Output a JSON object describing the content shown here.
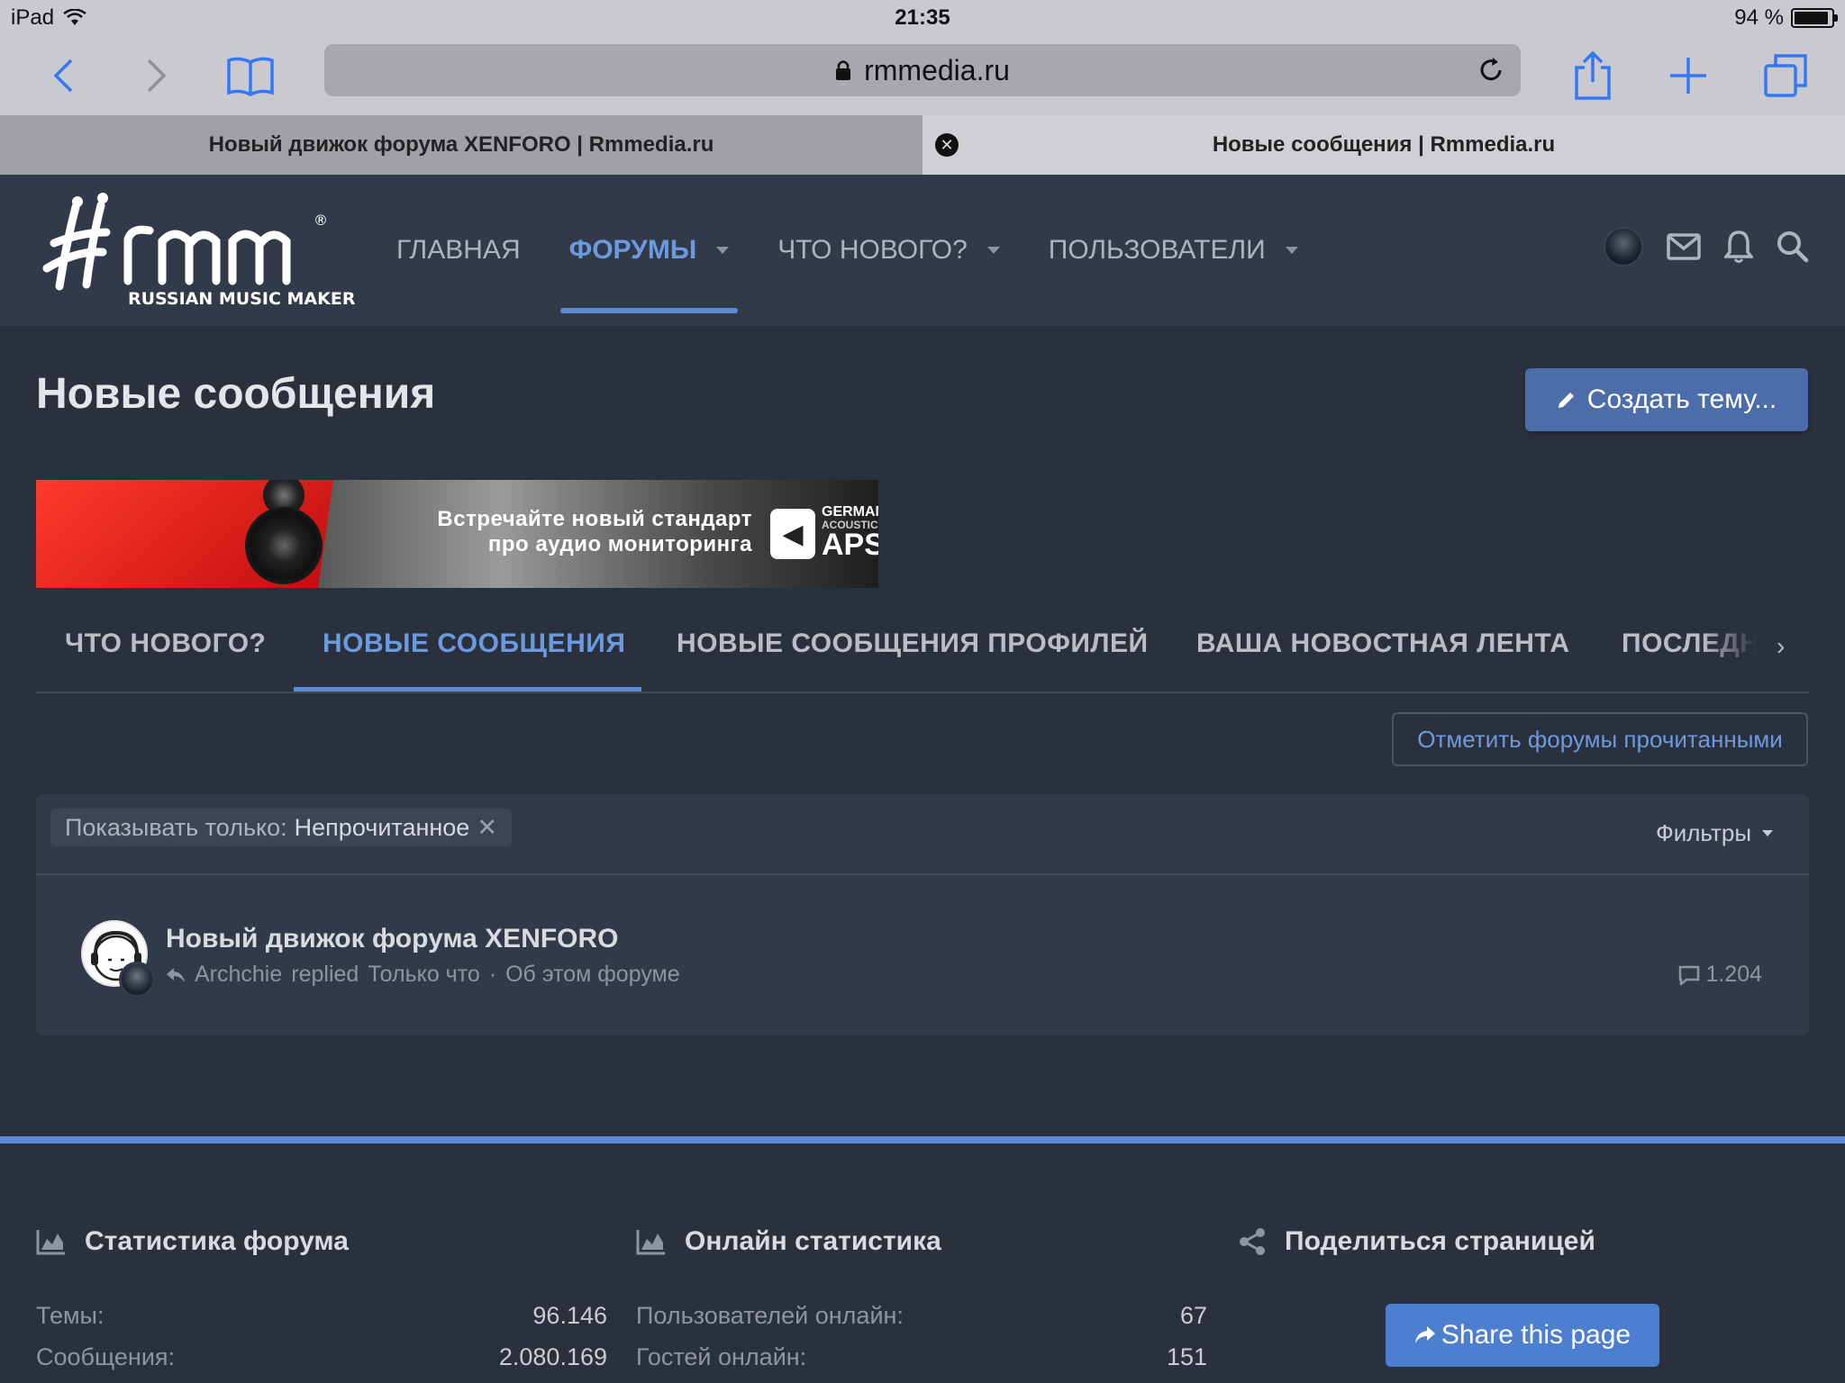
{
  "status_bar": {
    "device": "iPad",
    "time": "21:35",
    "battery": "94 %",
    "battery_level": 0.94
  },
  "browser": {
    "url": "rmmedia.ru",
    "tabs": [
      {
        "title": "Новый движок форума XENFORO | Rmmedia.ru",
        "active": false
      },
      {
        "title": "Новые сообщения | Rmmedia.ru",
        "active": true
      }
    ]
  },
  "site": {
    "logo_text": "RUSSIAN MUSIC MAKERS",
    "logo_mark": "rmm",
    "nav": [
      {
        "label": "ГЛАВНАЯ",
        "active": false,
        "dropdown": false
      },
      {
        "label": "ФОРУМЫ",
        "active": true,
        "dropdown": true
      },
      {
        "label": "ЧТО НОВОГО?",
        "active": false,
        "dropdown": true
      },
      {
        "label": "ПОЛЬЗОВАТЕЛИ",
        "active": false,
        "dropdown": true
      }
    ]
  },
  "page": {
    "title": "Новые сообщения",
    "create_button": "Создать тему..."
  },
  "banner": {
    "line1": "Встречайте новый стандарт",
    "line2": "про аудио мониторинга",
    "brand1": "GERMANO",
    "brand2": "ACOUSTICS",
    "brand3": "APS"
  },
  "sub_tabs": [
    {
      "label": "ЧТО НОВОГО?",
      "active": false
    },
    {
      "label": "НОВЫЕ СООБЩЕНИЯ",
      "active": true
    },
    {
      "label": "НОВЫЕ СООБЩЕНИЯ ПРОФИЛЕЙ",
      "active": false
    },
    {
      "label": "ВАША НОВОСТНАЯ ЛЕНТА",
      "active": false
    },
    {
      "label": "ПОСЛЕДНЯЯ",
      "active": false
    }
  ],
  "mark_read": "Отметить форумы прочитанными",
  "filter": {
    "label": "Показывать только:",
    "value": "Непрочитанное",
    "filters_button": "Фильтры"
  },
  "thread": {
    "title": "Новый движок форума XENFORO",
    "user": "Archchie",
    "action": "replied",
    "time": "Только что",
    "separator": "·",
    "forum": "Об этом форуме",
    "replies": "1.204"
  },
  "footer": {
    "forum_stats": {
      "heading": "Статистика форума",
      "rows": [
        {
          "label": "Темы:",
          "value": "96.146"
        },
        {
          "label": "Сообщения:",
          "value": "2.080.169"
        }
      ]
    },
    "online_stats": {
      "heading": "Онлайн статистика",
      "rows": [
        {
          "label": "Пользователей онлайн:",
          "value": "67"
        },
        {
          "label": "Гостей онлайн:",
          "value": "151"
        }
      ]
    },
    "share": {
      "heading": "Поделиться страницей",
      "button": "Share this page"
    }
  },
  "colors": {
    "accent": "#5b8ad6",
    "header_bg": "#323949",
    "page_bg": "#2b303d",
    "button_primary": "#4b6eab"
  },
  "icons": [
    "back-icon",
    "forward-icon",
    "bookmarks-icon",
    "lock-icon",
    "reload-icon",
    "share-icon",
    "new-tab-icon",
    "tabs-icon",
    "close-tab-icon",
    "mail-icon",
    "bell-icon",
    "search-icon",
    "pencil-icon",
    "reply-icon",
    "comment-icon",
    "chart-icon",
    "share-nodes-icon"
  ]
}
